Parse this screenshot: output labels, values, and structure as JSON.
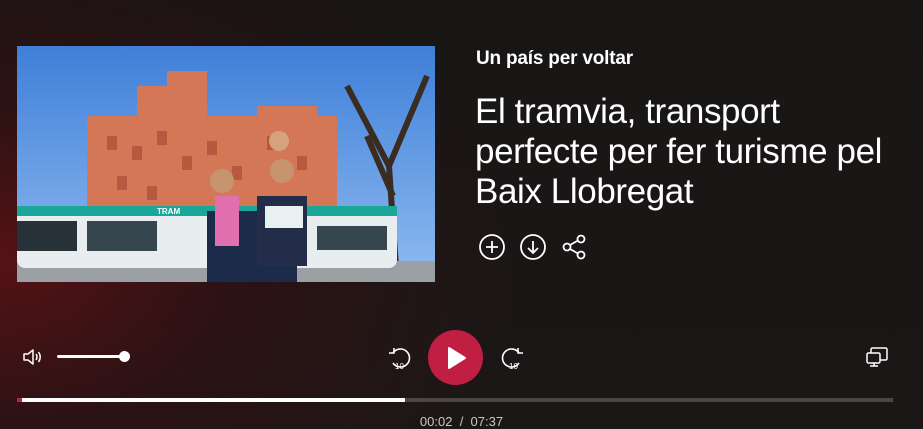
{
  "episode": {
    "program": "Un país per voltar",
    "title": "El tramvia, transport perfecte per fer turisme pel Baix Llobregat"
  },
  "thumbnail": {
    "tram_label": "TRAM"
  },
  "actions": [
    {
      "icon": "add-circle-icon"
    },
    {
      "icon": "download-circle-icon"
    },
    {
      "icon": "share-icon"
    }
  ],
  "player": {
    "volume": 0.98,
    "skip_back_seconds": "10",
    "skip_forward_seconds": "10",
    "current_time": "00:02",
    "separator": "/",
    "duration": "07:37",
    "progress_fraction": 0.443,
    "accent_color": "#c01f43"
  }
}
